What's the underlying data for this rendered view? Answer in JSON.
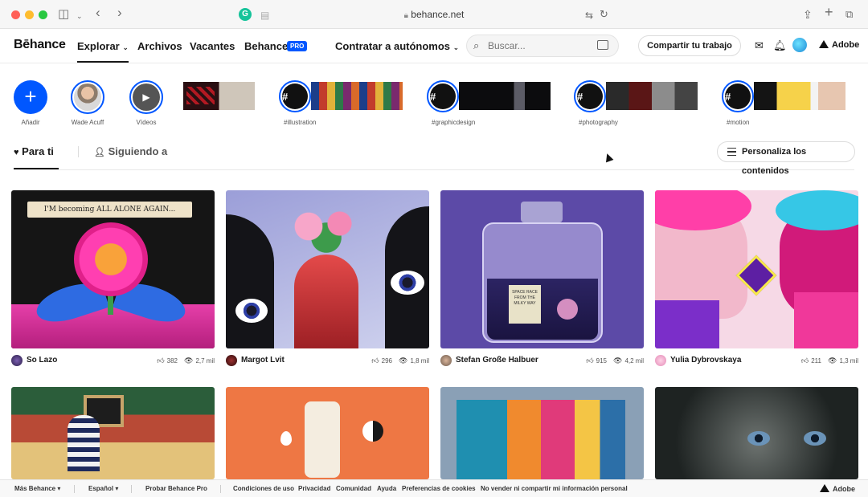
{
  "browser": {
    "url": "behance.net"
  },
  "header": {
    "logo": "Bēhance",
    "nav": {
      "explore": "Explorar",
      "archives": "Archivos",
      "jobs": "Vacantes",
      "behance_pro": "Behance",
      "pro_badge": "PRO",
      "hire": "Contratar a autónomos"
    },
    "search_placeholder": "Buscar...",
    "share_label": "Compartir tu trabajo",
    "adobe_label": "Adobe"
  },
  "stories": {
    "add_label": "Añadir",
    "user_label": "Wade Acuff",
    "videos_label": "Vídeos",
    "tags": [
      "#illustration",
      "#graphicdesign",
      "#photography",
      "#motion"
    ],
    "hash_symbol": "#"
  },
  "tabs": {
    "for_you": "Para ti",
    "following": "Siguiendo a",
    "personalize": "Personaliza los contenidos"
  },
  "projects": [
    {
      "owner": "So Lazo",
      "likes": "382",
      "views": "2,7 mil"
    },
    {
      "owner": "Margot Lvit",
      "likes": "296",
      "views": "1,8 mil"
    },
    {
      "owner": "Stefan Große Halbuer",
      "likes": "915",
      "views": "4,2 mil"
    },
    {
      "owner": "Yulia Dybrovskaya",
      "likes": "211",
      "views": "1,3 mil"
    }
  ],
  "artwork_text": {
    "flower_banner": "I'M becoming ALL ALONE AGAIN...",
    "bottle_label": "SPACE RACE FROM THE MILKY WAY"
  },
  "footer": {
    "more": "Más Behance ▾",
    "language": "Español ▾",
    "try_pro": "Probar Behance Pro",
    "terms": "Condiciones de uso",
    "privacy": "Privacidad",
    "community": "Comunidad",
    "help": "Ayuda",
    "cookies": "Preferencias de cookies",
    "no_sell": "No vender ni compartir mi información personal",
    "adobe": "Adobe"
  }
}
